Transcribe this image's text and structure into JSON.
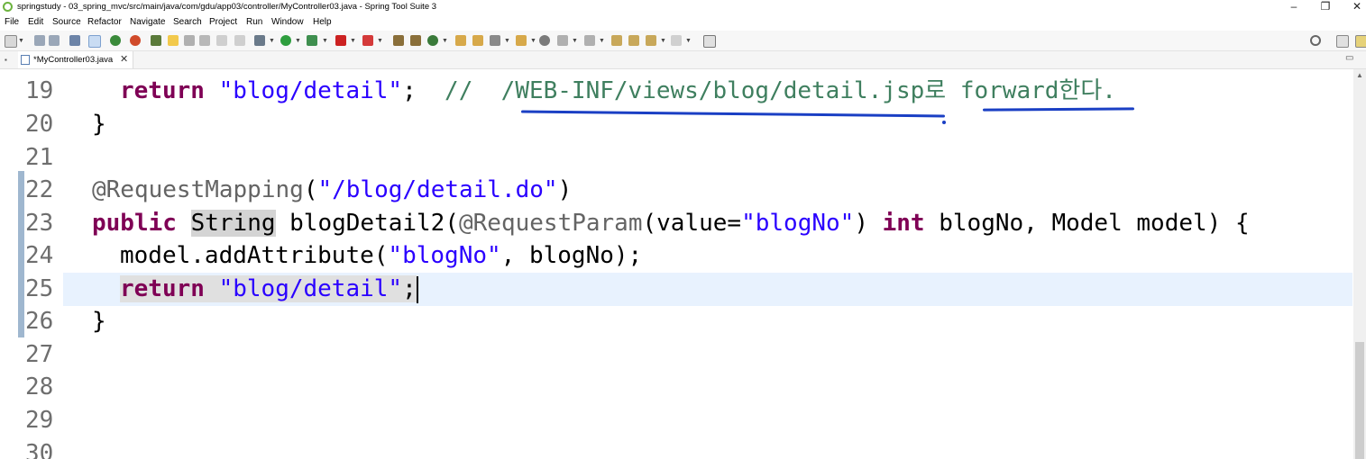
{
  "window": {
    "title": "springstudy - 03_spring_mvc/src/main/java/com/gdu/app03/controller/MyController03.java - Spring Tool Suite 3",
    "minimize": "–",
    "restore": "❐",
    "close": "✕"
  },
  "menu": [
    "File",
    "Edit",
    "Source",
    "Refactor",
    "Navigate",
    "Search",
    "Project",
    "Run",
    "Window",
    "Help"
  ],
  "editor_tab": {
    "label": "*MyController03.java",
    "close": "✕"
  },
  "lines": [
    {
      "num": "19"
    },
    {
      "num": "20"
    },
    {
      "num": "21"
    },
    {
      "num": "22"
    },
    {
      "num": "23"
    },
    {
      "num": "24"
    },
    {
      "num": "25"
    },
    {
      "num": "26"
    },
    {
      "num": "27"
    },
    {
      "num": "28"
    },
    {
      "num": "29"
    },
    {
      "num": "30"
    }
  ],
  "code": {
    "l19_kw": "return",
    "l19_str": "\"blog/detail\"",
    "l19_semi": ";  ",
    "l19_comment": "//  /WEB-INF/views/blog/detail.jsp로 forward한다.",
    "l20": "}",
    "l22_ann": "@RequestMapping",
    "l22_open": "(",
    "l22_str": "\"/blog/detail.do\"",
    "l22_close": ")",
    "l23_kw": "public",
    "l23_type": "String",
    "l23_method": " blogDetail2(",
    "l23_ann": "@RequestParam",
    "l23_p1": "(value=",
    "l23_str": "\"blogNo\"",
    "l23_p2": ") ",
    "l23_kw2": "int",
    "l23_p3": " blogNo, Model model) {",
    "l24_a": "model.addAttribute(",
    "l24_str": "\"blogNo\"",
    "l24_b": ", blogNo);",
    "l25_kw": "return",
    "l25_str": "\"blog/detail\"",
    "l25_semi": ";",
    "l26": "}"
  },
  "colors": {
    "keyword": "#7f0055",
    "string": "#2a00ff",
    "comment": "#3f7f5f",
    "annotation": "#646464",
    "current_line": "#e8f2fe"
  }
}
